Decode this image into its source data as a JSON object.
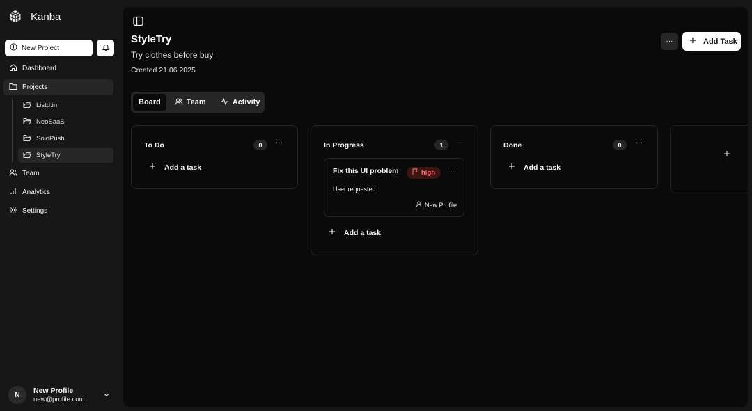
{
  "brand": {
    "name": "Kanba"
  },
  "sidebar": {
    "new_project_label": "New Project",
    "items": [
      {
        "label": "Dashboard"
      },
      {
        "label": "Projects"
      },
      {
        "label": "Team"
      },
      {
        "label": "Analytics"
      },
      {
        "label": "Settings"
      }
    ],
    "projects": [
      {
        "label": "Listd.in"
      },
      {
        "label": "NeoSaaS"
      },
      {
        "label": "SoloPush"
      },
      {
        "label": "StyleTry"
      }
    ]
  },
  "profile": {
    "initial": "N",
    "name": "New Profile",
    "email": "new@profile.com"
  },
  "project": {
    "title": "StyleTry",
    "subtitle": "Try clothes before buy",
    "created": "Created 21.06.2025"
  },
  "header": {
    "more_label": "···",
    "add_task_label": "Add Task"
  },
  "tabs": [
    {
      "label": "Board"
    },
    {
      "label": "Team"
    },
    {
      "label": "Activity"
    }
  ],
  "columns": [
    {
      "title": "To Do",
      "count": "0",
      "add_label": "Add a task"
    },
    {
      "title": "In Progress",
      "count": "1",
      "add_label": "Add a task"
    },
    {
      "title": "Done",
      "count": "0",
      "add_label": "Add a task"
    }
  ],
  "task": {
    "title": "Fix this UI problem",
    "priority": "high",
    "description": "User requested",
    "assignee": "New Profile"
  },
  "colors": {
    "accent": "#ffffff",
    "priority_high_bg": "#3b1414",
    "priority_high_fg": "#f87171"
  }
}
